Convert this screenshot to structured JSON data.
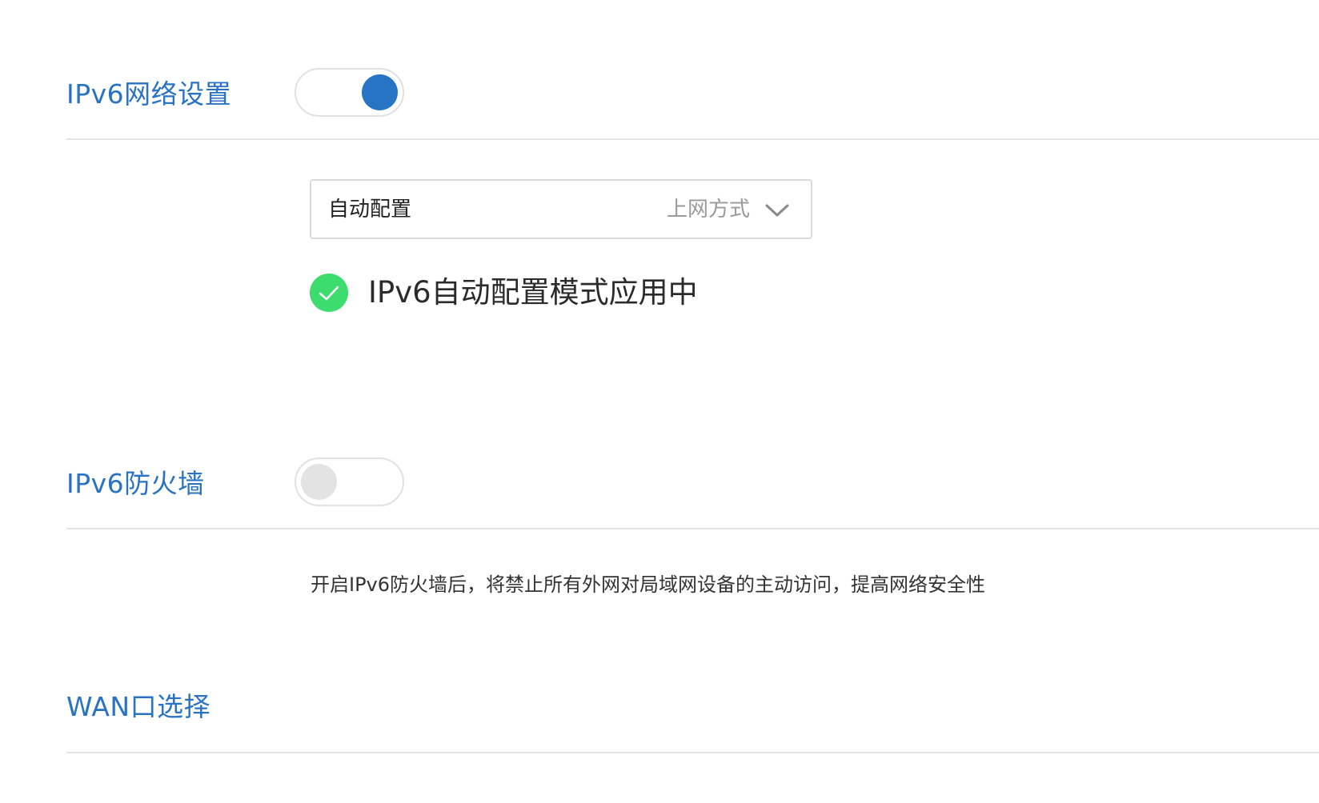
{
  "ipv6_network": {
    "title": "IPv6网络设置",
    "toggle_state": "on",
    "mode_select": {
      "value": "自动配置",
      "hint": "上网方式",
      "icon": "chevron-down-icon"
    },
    "status": {
      "icon": "check-circle-icon",
      "text": "IPv6自动配置模式应用中"
    }
  },
  "ipv6_firewall": {
    "title": "IPv6防火墙",
    "toggle_state": "off",
    "description": "开启IPv6防火墙后，将禁止所有外网对局域网设备的主动访问，提高网络安全性"
  },
  "wan_port": {
    "title": "WAN口选择"
  },
  "colors": {
    "accent": "#2a73c2",
    "toggle_on": "#2874c4",
    "toggle_off_knob": "#e3e3e3",
    "success": "#3ddc6e"
  }
}
